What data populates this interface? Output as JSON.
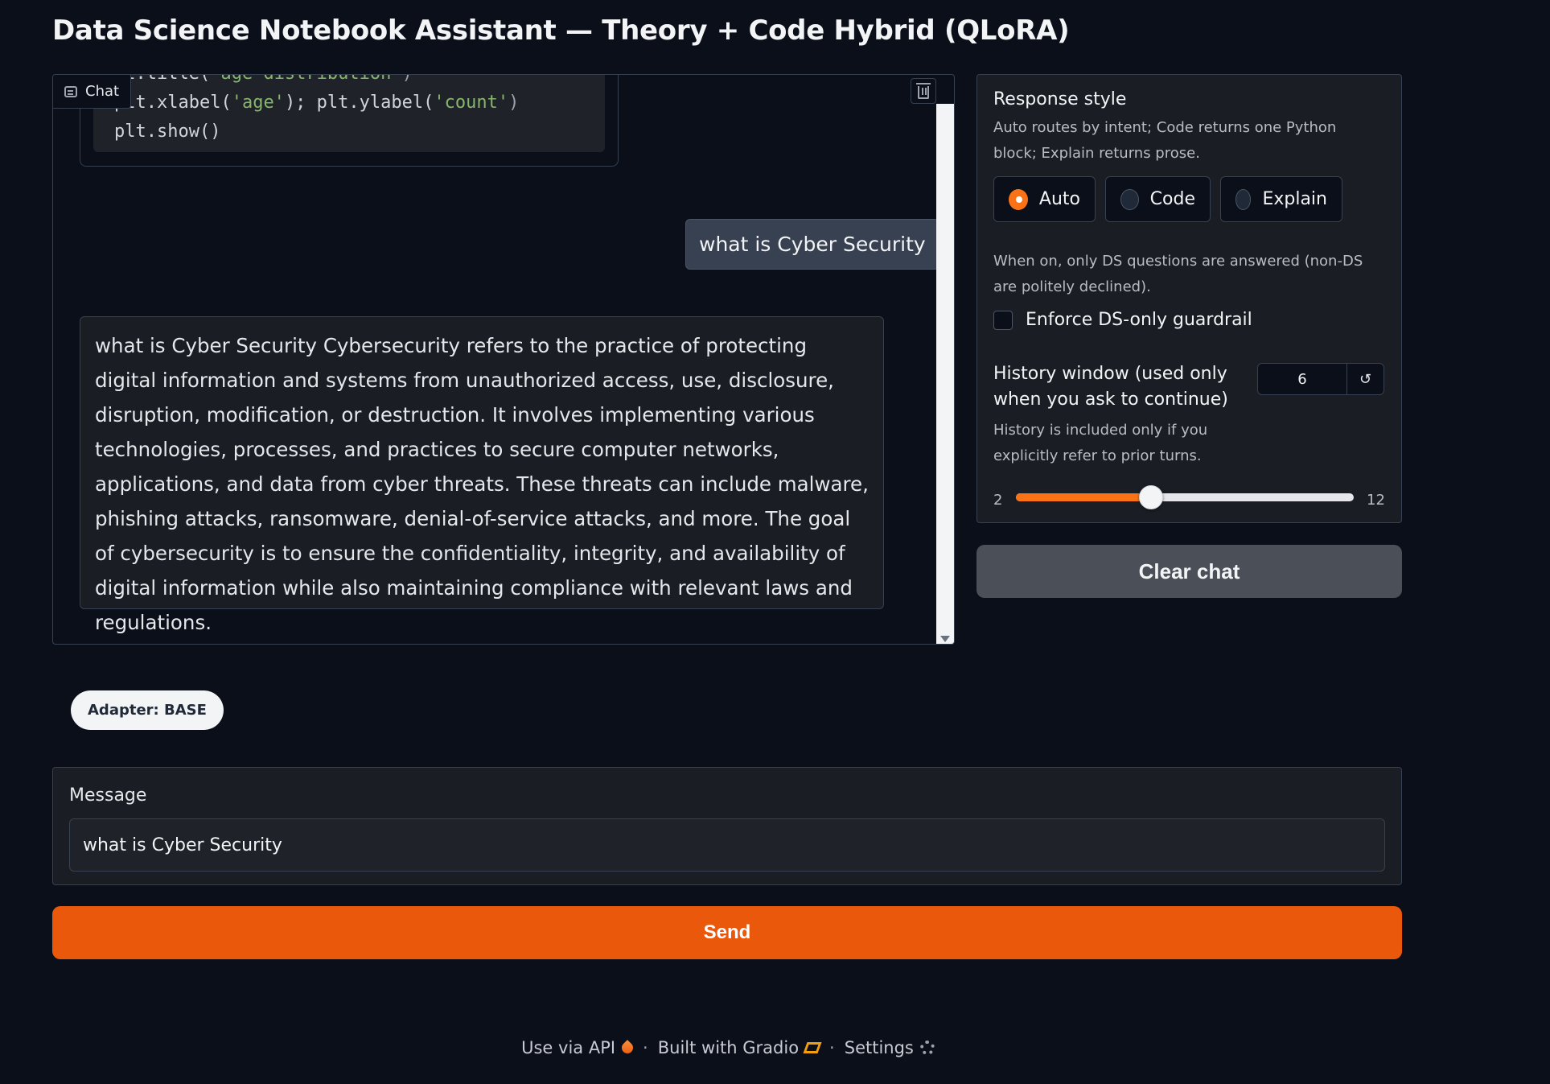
{
  "page": {
    "title": "Data Science Notebook Assistant — Theory + Code Hybrid (QLoRA)"
  },
  "chat": {
    "label": "Chat",
    "code_lines": [
      {
        "prefix": "lt.title(",
        "string": "'age distribution'",
        "suffix": ")"
      },
      {
        "prefix": "plt.xlabel(",
        "string": "'age'",
        "middle": "); plt.ylabel(",
        "string2": "'count'",
        "suffix": ")"
      },
      {
        "prefix": "plt.show()"
      }
    ],
    "user_message": "what is Cyber Security",
    "bot_message": "what is Cyber Security Cybersecurity refers to the practice of protecting digital information and systems from unauthorized access, use, disclosure, disruption, modification, or destruction. It involves implementing various technologies, processes, and practices to secure computer networks, applications, and data from cyber threats. These threats can include malware, phishing attacks, ransomware, denial-of-service attacks, and more. The goal of cybersecurity is to ensure the confidentiality, integrity, and availability of digital information while also maintaining compliance with relevant laws and regulations."
  },
  "settings": {
    "response_style": {
      "label": "Response style",
      "info": "Auto routes by intent; Code returns one Python block; Explain returns prose.",
      "options": [
        "Auto",
        "Code",
        "Explain"
      ],
      "selected": "Auto"
    },
    "guardrail": {
      "info": "When on, only DS questions are answered (non-DS are politely declined).",
      "label": "Enforce DS-only guardrail",
      "checked": false
    },
    "history": {
      "label": "History window (used only when you ask to continue)",
      "info": "History is included only if you explicitly refer to prior turns.",
      "value": "6",
      "reset_icon": "↺",
      "min": "2",
      "max": "12",
      "fraction": 0.4
    },
    "clear_label": "Clear chat"
  },
  "adapter_badge": "Adapter: BASE",
  "message": {
    "label": "Message",
    "value": "what is Cyber Security"
  },
  "send_label": "Send",
  "footer": {
    "api": "Use via API",
    "gradio": "Built with Gradio",
    "settings": "Settings",
    "separator": "·"
  },
  "colors": {
    "accent": "#f97316",
    "send": "#ea580c",
    "background": "#0b0f19"
  }
}
